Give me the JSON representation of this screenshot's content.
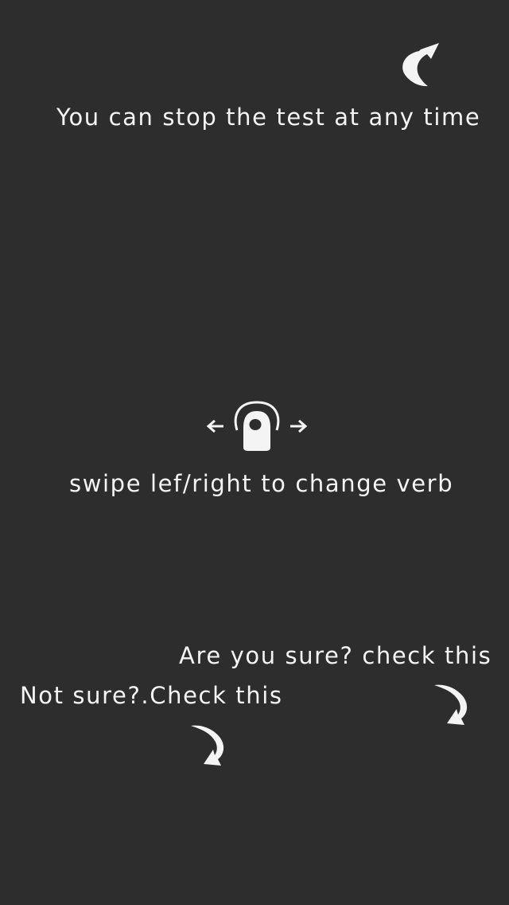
{
  "tutorial": {
    "stop_hint": "You can stop the test at any time",
    "swipe_hint": "swipe lef/right to change verb",
    "sure_hint": "Are you sure? check this",
    "not_sure_hint": "Not sure?.Check this"
  },
  "icons": {
    "stop_arrow": "curved-arrow-up-right-icon",
    "swipe": "swipe-finger-icon",
    "sure_arrow": "curved-arrow-down-icon",
    "not_sure_arrow": "curved-arrow-down-icon"
  },
  "colors": {
    "background": "#2d2d2d",
    "foreground": "#f4f4f4"
  }
}
